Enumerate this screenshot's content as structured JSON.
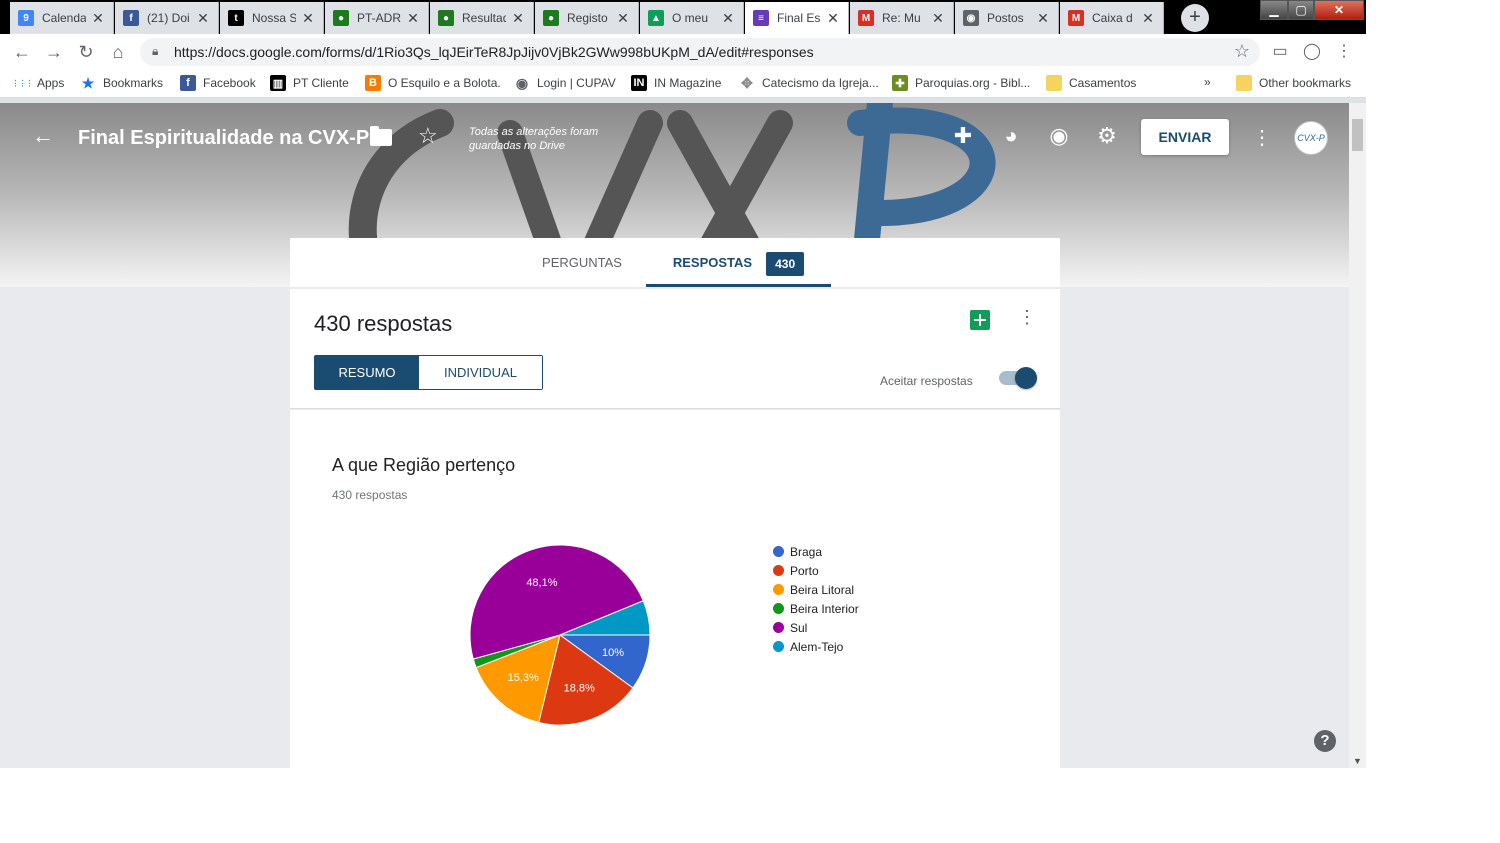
{
  "browser": {
    "tabs": [
      {
        "label": "Calendar",
        "icon": "calendar-icon",
        "color": "#4285f4",
        "glyph": "9",
        "active": false
      },
      {
        "label": "(21) Doi",
        "icon": "facebook-icon",
        "color": "#3b5998",
        "glyph": "f",
        "active": false
      },
      {
        "label": "Nossa S",
        "icon": "tumblr-icon",
        "color": "#000000",
        "glyph": "t",
        "active": false
      },
      {
        "label": "PT-ADR",
        "icon": "pt-icon",
        "color": "#1e7a1e",
        "glyph": "●",
        "active": false
      },
      {
        "label": "Resultad",
        "icon": "pt-icon",
        "color": "#1e7a1e",
        "glyph": "●",
        "active": false
      },
      {
        "label": "Registo",
        "icon": "pt-icon",
        "color": "#1e7a1e",
        "glyph": "●",
        "active": false
      },
      {
        "label": "O meu",
        "icon": "drive-icon",
        "color": "#0f9d58",
        "glyph": "▲",
        "active": false
      },
      {
        "label": "Final Es",
        "icon": "forms-icon",
        "color": "#673ab7",
        "glyph": "≡",
        "active": true
      },
      {
        "label": "Re: Mu",
        "icon": "gmail-icon",
        "color": "#d93025",
        "glyph": "M",
        "active": false
      },
      {
        "label": "Postos",
        "icon": "globe-icon",
        "color": "#5f6368",
        "glyph": "◉",
        "active": false
      },
      {
        "label": "Caixa d",
        "icon": "gmail-icon",
        "color": "#d93025",
        "glyph": "M",
        "active": false
      }
    ],
    "url": "https://docs.google.com/forms/d/1Rio3Qs_lqJEirTeR8JpJijv0VjBk2GWw998bUKpM_dA/edit#responses",
    "bookmarks": [
      {
        "label": "Apps",
        "icon": "apps-grid-icon",
        "color": "#5f6368",
        "glyph": "⋮⋮⋮"
      },
      {
        "label": "Bookmarks",
        "icon": "star-icon",
        "color": "#1a73e8",
        "glyph": "★"
      },
      {
        "label": "Facebook",
        "icon": "facebook-icon",
        "color": "#3b5998",
        "glyph": "f"
      },
      {
        "label": "PT Cliente",
        "icon": "pt-cliente-icon",
        "color": "#000000",
        "glyph": "▥"
      },
      {
        "label": "O Esquilo e a Bolota.",
        "icon": "blogger-icon",
        "color": "#f57c00",
        "glyph": "B"
      },
      {
        "label": "Login | CUPAV",
        "icon": "globe-icon",
        "color": "#5f6368",
        "glyph": "◉"
      },
      {
        "label": "IN Magazine",
        "icon": "in-magazine-icon",
        "color": "#000000",
        "glyph": "IN"
      },
      {
        "label": "Catecismo da Igreja...",
        "icon": "catecismo-icon",
        "color": "#8a8a8a",
        "glyph": "✥"
      },
      {
        "label": "Paroquias.org - Bibl...",
        "icon": "paroquias-icon",
        "color": "#6b8e23",
        "glyph": "✚"
      },
      {
        "label": "Casamentos",
        "icon": "folder-icon",
        "color": "#f4d35e",
        "glyph": ""
      },
      {
        "label": "»",
        "icon": "more-bookmarks-icon",
        "color": "#5f6368",
        "glyph": ""
      },
      {
        "label": "Other bookmarks",
        "icon": "folder-icon",
        "color": "#f4d35e",
        "glyph": ""
      }
    ]
  },
  "header": {
    "title": "Final Espiritualidade na CVX-P",
    "save_status": "Todas as alterações foram guardadas no Drive",
    "send_label": "ENVIAR",
    "avatar_text": "CVX-P"
  },
  "tabs": {
    "questions_label": "PERGUNTAS",
    "responses_label": "RESPOSTAS",
    "responses_count": "430"
  },
  "summary": {
    "heading": "430 respostas",
    "summary_label": "RESUMO",
    "individual_label": "INDIVIDUAL",
    "accept_label": "Aceitar respostas",
    "accepting": true
  },
  "question": {
    "title": "A que Região pertenço",
    "count_label": "430 respostas"
  },
  "chart_data": {
    "type": "pie",
    "categories": [
      "Braga",
      "Porto",
      "Beira Litoral",
      "Beira Interior",
      "Sul",
      "Alem-Tejo"
    ],
    "values": [
      10,
      18.8,
      15.3,
      1.6,
      48.1,
      6.2
    ],
    "data_labels": [
      "10%",
      "18,8%",
      "15,3%",
      "",
      "48,1%",
      ""
    ],
    "colors": [
      "#3366cc",
      "#dc3912",
      "#ff9900",
      "#109618",
      "#990099",
      "#0099c6"
    ],
    "legend": "right"
  }
}
